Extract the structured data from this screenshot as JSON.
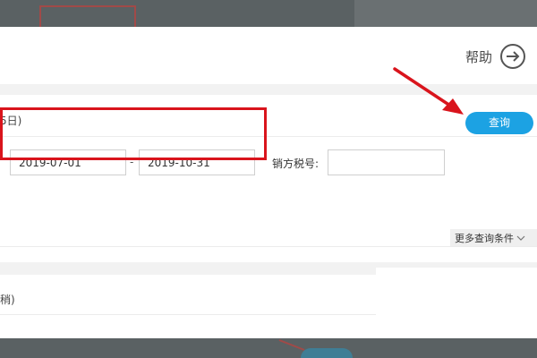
{
  "modal": {
    "help_label": "帮助",
    "section1_title": "5日)",
    "section2_title": "稍)",
    "query_button": "查询",
    "date_start": "2019-07-01",
    "date_separator": "-",
    "date_end": "2019-10-31",
    "seller_tax_label": "销方税号:",
    "seller_tax_value": "",
    "more_conditions": "更多查询条件"
  },
  "colors": {
    "accent": "#1ca2e3",
    "annotation_red": "#d9141c"
  }
}
